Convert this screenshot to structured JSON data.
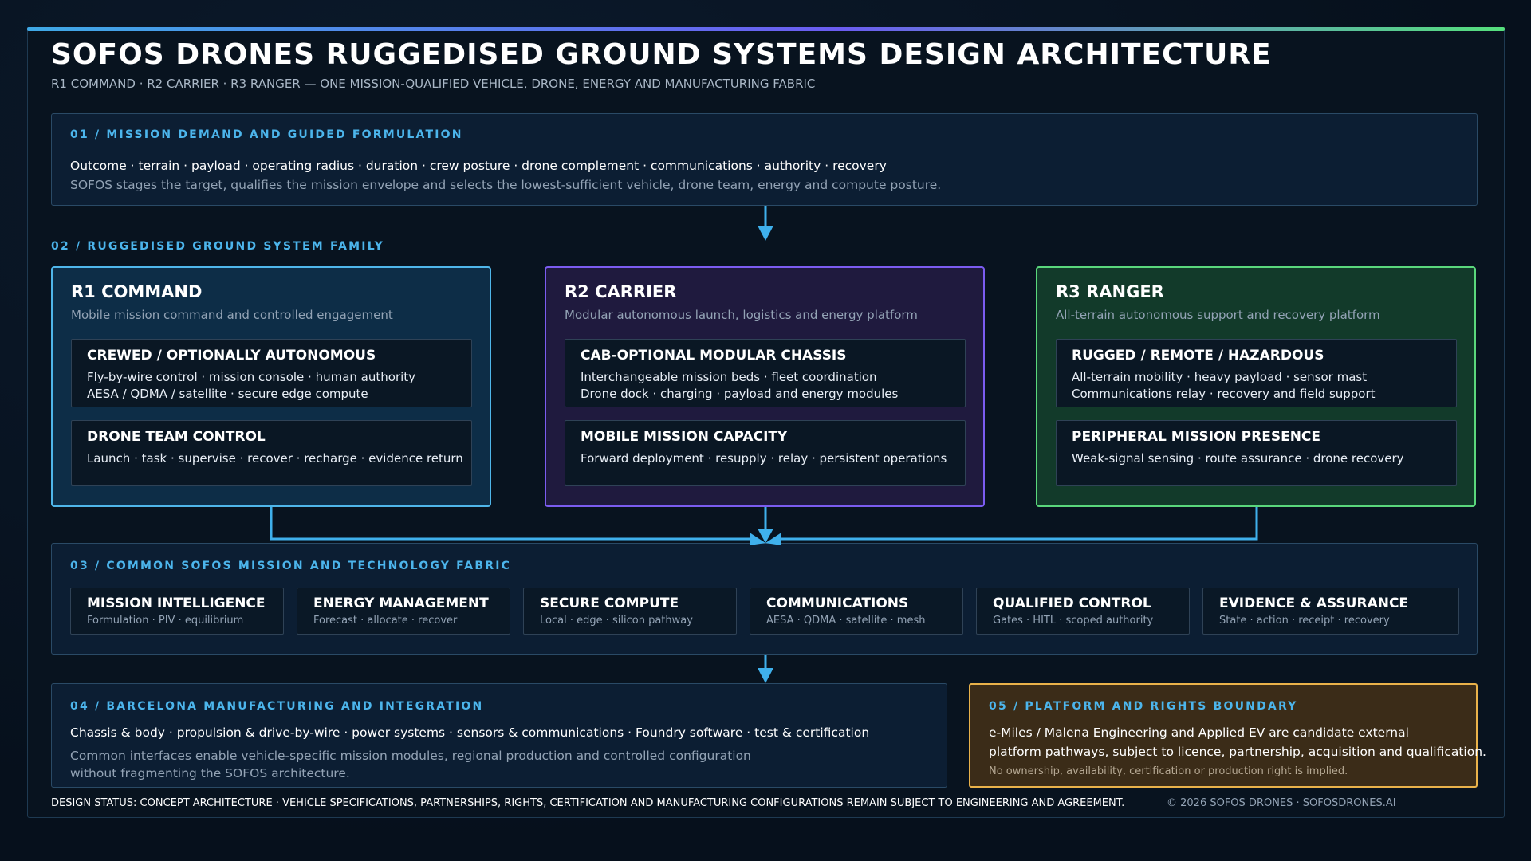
{
  "header": {
    "title": "SOFOS DRONES RUGGEDISED GROUND SYSTEMS DESIGN ARCHITECTURE",
    "subtitle": "R1 COMMAND · R2 CARRIER · R3 RANGER — ONE MISSION-QUALIFIED VEHICLE, DRONE, ENERGY AND MANUFACTURING FABRIC"
  },
  "section1": {
    "kicker": "01 / MISSION DEMAND AND GUIDED FORMULATION",
    "line1": "Outcome · terrain · payload · operating radius · duration · crew posture · drone complement · communications · authority · recovery",
    "line2": "SOFOS stages the target, qualifies the mission envelope and selects the lowest-sufficient vehicle, drone team, energy and compute posture."
  },
  "section2": {
    "kicker": "02 / RUGGEDISED GROUND SYSTEM FAMILY",
    "r1": {
      "name": "R1 COMMAND",
      "desc": "Mobile mission command and controlled engagement",
      "card1": {
        "title": "CREWED / OPTIONALLY AUTONOMOUS",
        "line1": "Fly-by-wire control · mission console · human authority",
        "line2": "AESA / QDMA / satellite · secure edge compute"
      },
      "card2": {
        "title": "DRONE TEAM CONTROL",
        "line1": "Launch · task · supervise · recover · recharge · evidence return"
      }
    },
    "r2": {
      "name": "R2 CARRIER",
      "desc": "Modular autonomous launch, logistics and energy platform",
      "card1": {
        "title": "CAB-OPTIONAL MODULAR CHASSIS",
        "line1": "Interchangeable mission beds · fleet coordination",
        "line2": "Drone dock · charging · payload and energy modules"
      },
      "card2": {
        "title": "MOBILE MISSION CAPACITY",
        "line1": "Forward deployment · resupply · relay · persistent operations"
      }
    },
    "r3": {
      "name": "R3 RANGER",
      "desc": "All-terrain autonomous support and recovery platform",
      "card1": {
        "title": "RUGGED / REMOTE / HAZARDOUS",
        "line1": "All-terrain mobility · heavy payload · sensor mast",
        "line2": "Communications relay · recovery and field support"
      },
      "card2": {
        "title": "PERIPHERAL MISSION PRESENCE",
        "line1": "Weak-signal sensing · route assurance · drone recovery"
      }
    }
  },
  "section3": {
    "kicker": "03 / COMMON SOFOS MISSION AND TECHNOLOGY FABRIC",
    "items": [
      {
        "title": "MISSION INTELLIGENCE",
        "sub": "Formulation · PIV · equilibrium"
      },
      {
        "title": "ENERGY MANAGEMENT",
        "sub": "Forecast · allocate · recover"
      },
      {
        "title": "SECURE COMPUTE",
        "sub": "Local · edge · silicon pathway"
      },
      {
        "title": "COMMUNICATIONS",
        "sub": "AESA · QDMA · satellite · mesh"
      },
      {
        "title": "QUALIFIED CONTROL",
        "sub": "Gates · HITL · scoped authority"
      },
      {
        "title": "EVIDENCE & ASSURANCE",
        "sub": "State · action · receipt · recovery"
      }
    ]
  },
  "section4": {
    "kicker": "04 / BARCELONA MANUFACTURING AND INTEGRATION",
    "line1": "Chassis & body · propulsion & drive-by-wire · power systems · sensors & communications · Foundry software · test & certification",
    "line2a": "Common interfaces enable vehicle-specific mission modules, regional production and controlled configuration",
    "line2b": "without fragmenting the SOFOS architecture."
  },
  "section5": {
    "kicker": "05 / PLATFORM AND RIGHTS BOUNDARY",
    "line1a": "e-Miles / Malena Engineering and Applied EV are candidate external",
    "line1b": "platform pathways, subject to licence, partnership, acquisition and qualification.",
    "line2": "No ownership, availability, certification or production right is implied."
  },
  "footer": {
    "status": "DESIGN STATUS: CONCEPT ARCHITECTURE · VEHICLE SPECIFICATIONS, PARTNERSHIPS, RIGHTS, CERTIFICATION AND MANUFACTURING CONFIGURATIONS REMAIN SUBJECT TO ENGINEERING AND AGREEMENT.",
    "copyright": "© 2026 SOFOS DRONES · SOFOSDRONES.AI"
  },
  "colors": {
    "accent_blue": "#4cb5ec",
    "r1_border": "#4fb6ea",
    "r2_border": "#7b5cf0",
    "r3_border": "#5ad77c",
    "boundary_border": "#e9b24a"
  }
}
